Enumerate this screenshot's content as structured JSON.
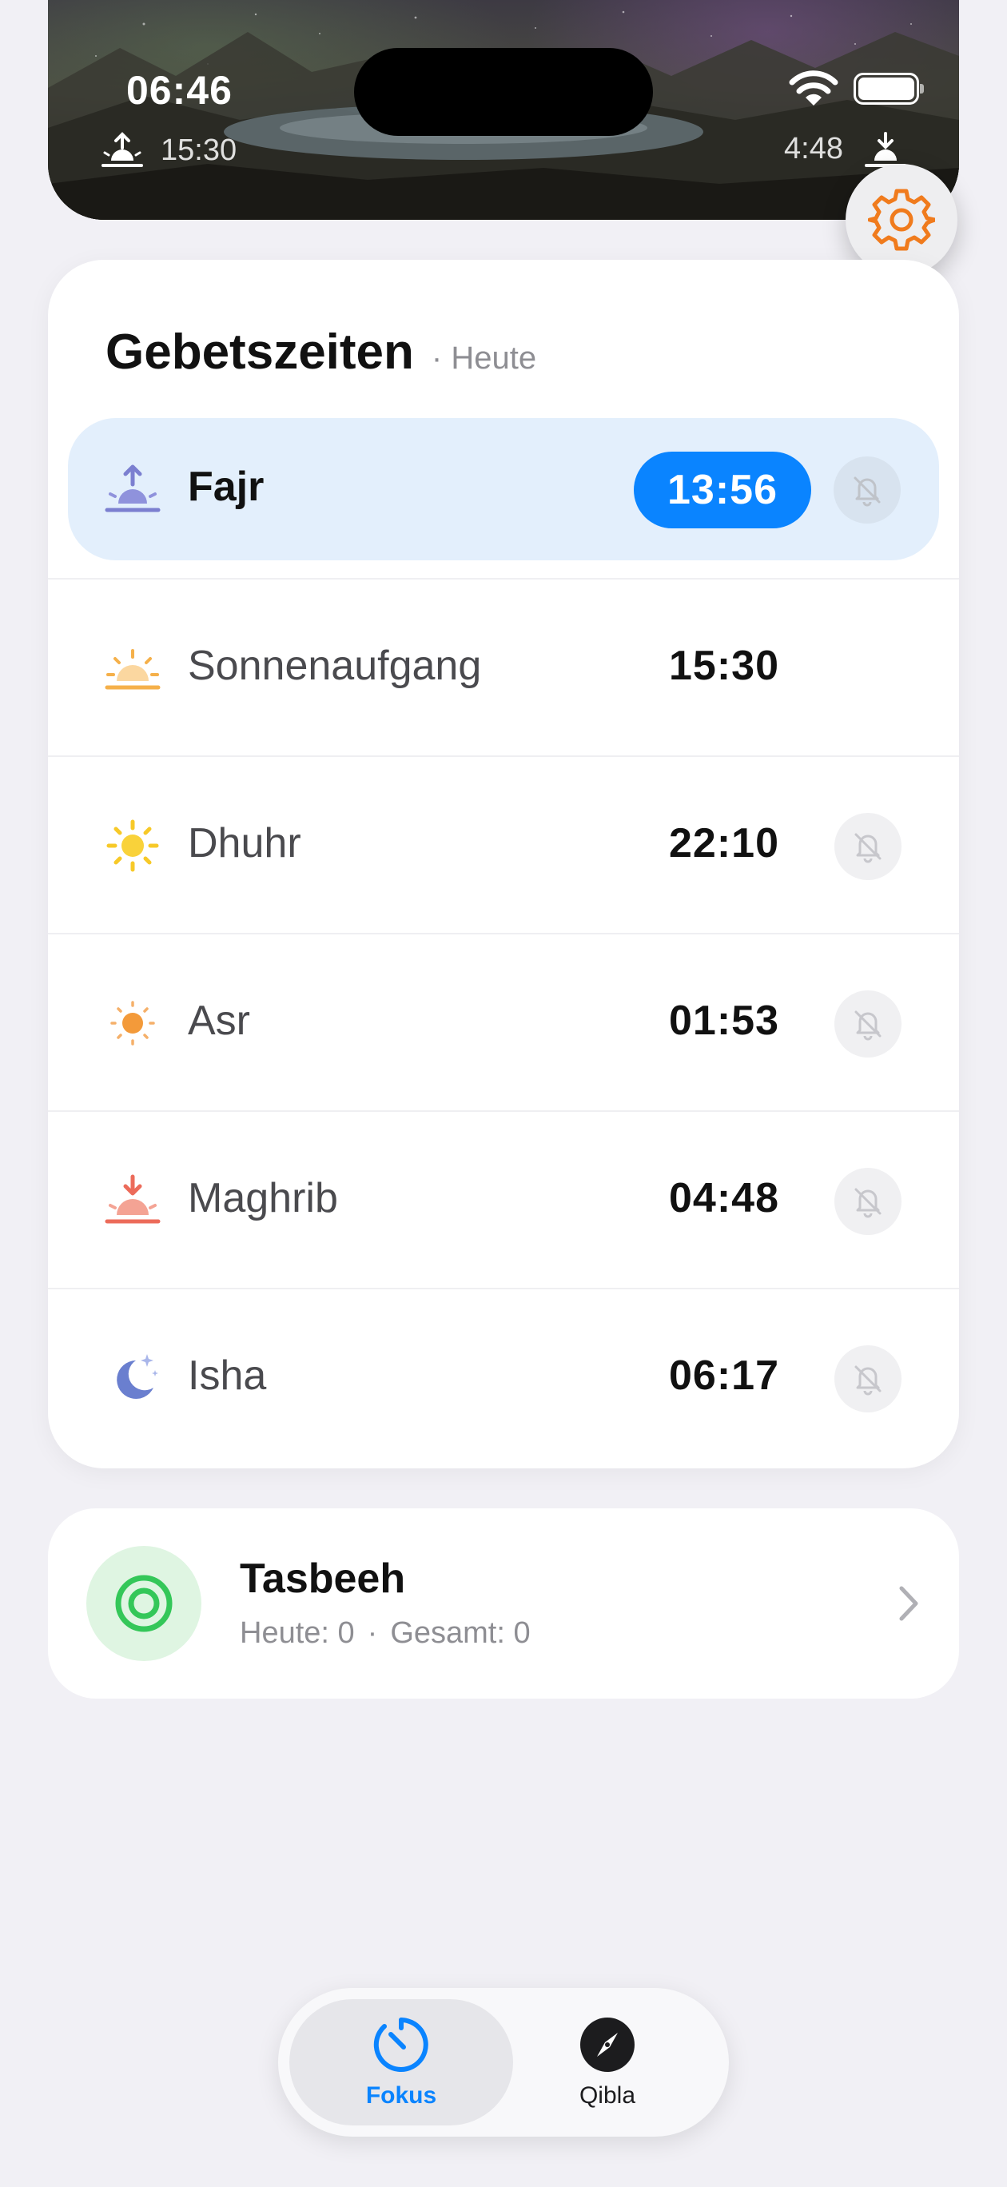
{
  "status_bar": {
    "time": "06:46"
  },
  "hero": {
    "sunrise_time": "15:30",
    "sunset_time": "4:48"
  },
  "prayer_card": {
    "title": "Gebetszeiten",
    "subtitle": "· Heute",
    "rows": [
      {
        "name": "Fajr",
        "time": "13:56",
        "icon": "fajr-sunrise-arrow-icon",
        "icon_color": "#7b7fd0",
        "active": true,
        "bell": true
      },
      {
        "name": "Sonnenaufgang",
        "time": "15:30",
        "icon": "sunrise-icon",
        "icon_color": "#f5b04a",
        "active": false,
        "bell": false
      },
      {
        "name": "Dhuhr",
        "time": "22:10",
        "icon": "sun-icon",
        "icon_color": "#f7c928",
        "active": false,
        "bell": true
      },
      {
        "name": "Asr",
        "time": "01:53",
        "icon": "small-sun-icon",
        "icon_color": "#f39a3a",
        "active": false,
        "bell": true
      },
      {
        "name": "Maghrib",
        "time": "04:48",
        "icon": "sunset-icon",
        "icon_color": "#ec6b5a",
        "active": false,
        "bell": true
      },
      {
        "name": "Isha",
        "time": "06:17",
        "icon": "moon-stars-icon",
        "icon_color": "#6a7fcf",
        "active": false,
        "bell": true
      }
    ]
  },
  "tasbeeh": {
    "title": "Tasbeeh",
    "today": "Heute: 0",
    "separator": "·",
    "total": "Gesamt: 0"
  },
  "tabbar": {
    "tabs": [
      {
        "label": "Fokus",
        "icon": "timer-icon",
        "selected": true
      },
      {
        "label": "Qibla",
        "icon": "compass-icon",
        "selected": false
      }
    ]
  },
  "colors": {
    "accent": "#0a84ff",
    "active_row": "#e3effc",
    "settings_icon": "#f07b1d",
    "tasbeeh_green": "#34c759",
    "background": "#f1f0f5"
  }
}
